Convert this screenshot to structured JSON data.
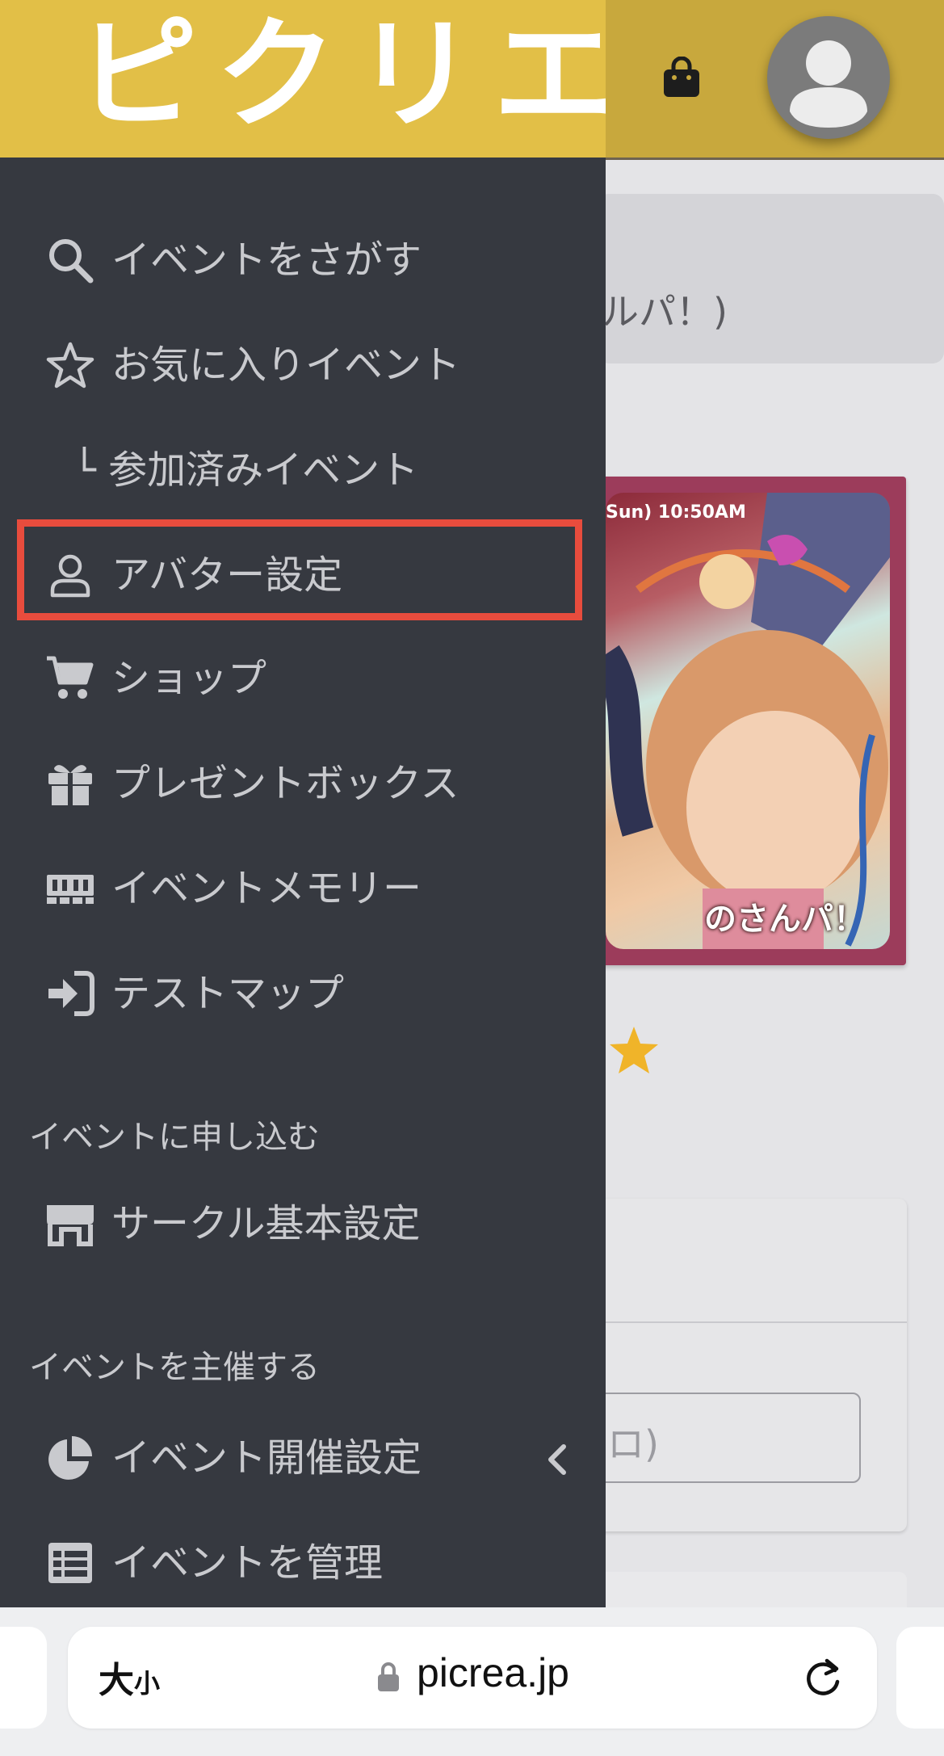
{
  "header": {
    "logo_text": "ピクリエ",
    "shop_icon": "shopping-bag-icon",
    "avatar_icon": "user-avatar-icon"
  },
  "background_page": {
    "panel_text": "ルパ！)",
    "banner": {
      "date_text": "Sun) 10:50AM",
      "caption_text": "のさんパ！"
    },
    "input_placeholder": "ロ)"
  },
  "sidebar": {
    "items": [
      {
        "label": "イベントをさがす",
        "icon": "search-icon"
      },
      {
        "label": "お気に入りイベント",
        "icon": "star-outline-icon"
      },
      {
        "label": "└ 参加済みイベント",
        "icon": ""
      },
      {
        "label": "アバター設定",
        "icon": "user-outline-icon",
        "highlighted": true
      },
      {
        "label": "ショップ",
        "icon": "cart-icon"
      },
      {
        "label": "プレゼントボックス",
        "icon": "gift-icon"
      },
      {
        "label": "イベントメモリー",
        "icon": "memory-icon"
      },
      {
        "label": "テストマップ",
        "icon": "sign-in-icon"
      }
    ],
    "section_apply": {
      "heading": "イベントに申し込む",
      "items": [
        {
          "label": "サークル基本設定",
          "icon": "store-icon"
        }
      ]
    },
    "section_host": {
      "heading": "イベントを主催する",
      "items": [
        {
          "label": "イベント開催設定",
          "icon": "pie-chart-icon",
          "expandable": true
        },
        {
          "label": "イベントを管理",
          "icon": "table-icon"
        }
      ]
    },
    "highlight_color": "#e84c3d",
    "background_color": "#363940"
  },
  "browser": {
    "text_size_label_large": "大",
    "text_size_label_small": "小",
    "url": "picrea.jp",
    "lock_icon": "lock-icon",
    "reload_icon": "reload-icon"
  },
  "colors": {
    "brand_yellow": "#e2bf47",
    "star_yellow": "#f0b429"
  }
}
